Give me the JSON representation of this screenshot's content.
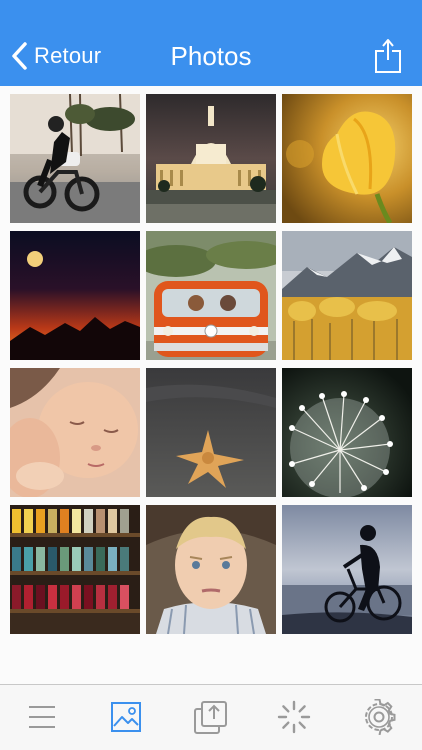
{
  "header": {
    "back_label": "Retour",
    "title": "Photos",
    "share_icon": "share-icon",
    "color": "#3b90ee"
  },
  "gallery": {
    "photos": [
      "motorcycle-rider",
      "capitol-building-night",
      "yellow-tulip",
      "moon-sunset-mountains",
      "orange-vw-van",
      "autumn-mountain-forest",
      "sleeping-baby",
      "starfish-on-sand",
      "dandelion-seed-head",
      "thread-spools",
      "boy-portrait",
      "bicycle-silhouette-sea"
    ]
  },
  "toolbar": {
    "icons": [
      "menu-icon",
      "photos-icon",
      "upload-icon",
      "activity-icon",
      "settings-icon"
    ],
    "active": "photos-icon",
    "active_color": "#3b90ee",
    "inactive_color": "#9a9a9a"
  }
}
